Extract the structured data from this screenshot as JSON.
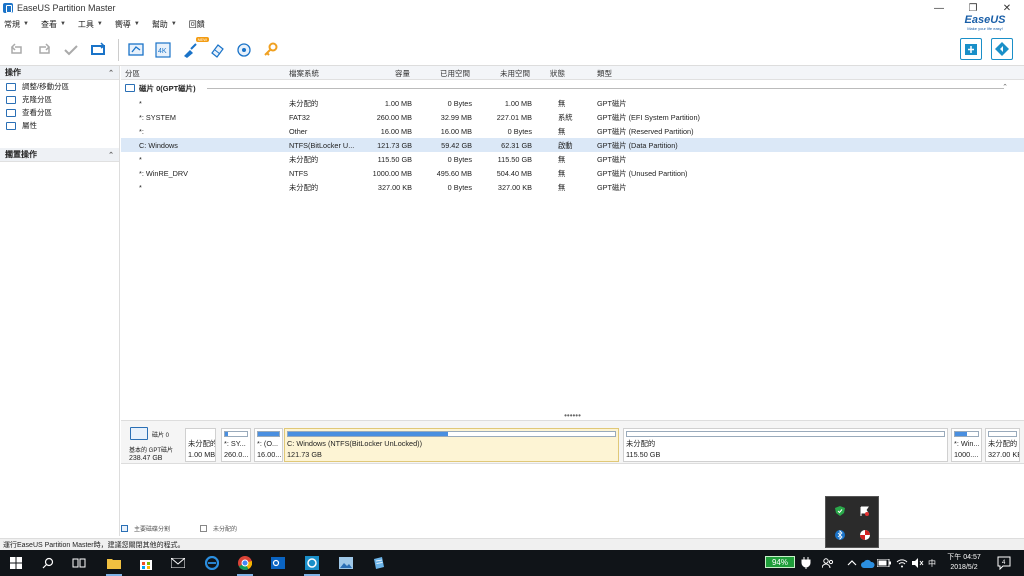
{
  "window": {
    "title": "EaseUS Partition Master",
    "minimize": "—",
    "maximize": "❐",
    "close": "✕"
  },
  "brand": {
    "name": "EaseUS",
    "tagline": "Make your life easy!"
  },
  "menu": [
    {
      "label": "常規"
    },
    {
      "label": "查看"
    },
    {
      "label": "工具"
    },
    {
      "label": "嚮導"
    },
    {
      "label": "幫助"
    },
    {
      "label": "回饋"
    }
  ],
  "toolbar": {
    "new_badge": "NEW",
    "icons": [
      "undo-icon",
      "redo-icon",
      "apply-icon",
      "refresh-icon",
      "migrate-os-icon",
      "4k-align-icon",
      "cleanup-icon",
      "wipe-icon",
      "disk-check-icon",
      "key-icon"
    ],
    "right_icons": [
      "winpe-icon",
      "layout-icon"
    ]
  },
  "left_panel": {
    "operations_header": "操作",
    "operations": [
      {
        "label": "調整/移動分區",
        "icon": "resize-icon"
      },
      {
        "label": "克隆分區",
        "icon": "clone-icon"
      },
      {
        "label": "查看分區",
        "icon": "explore-icon"
      },
      {
        "label": "屬性",
        "icon": "properties-icon"
      }
    ],
    "pending_header": "擱置操作"
  },
  "table": {
    "headers": [
      "分區",
      "檔案系統",
      "容量",
      "已用空間",
      "未用空間",
      "狀態",
      "類型"
    ],
    "disk_label": "磁片 0(GPT磁片)",
    "rows": [
      {
        "partition": "*",
        "fs": "未分配的",
        "capacity": "1.00 MB",
        "used": "0 Bytes",
        "unused": "1.00 MB",
        "status": "無",
        "type": "GPT磁片"
      },
      {
        "partition": "*: SYSTEM",
        "fs": "FAT32",
        "capacity": "260.00 MB",
        "used": "32.99 MB",
        "unused": "227.01 MB",
        "status": "系統",
        "type": "GPT磁片 (EFI System Partition)"
      },
      {
        "partition": "*:",
        "fs": "Other",
        "capacity": "16.00 MB",
        "used": "16.00 MB",
        "unused": "0 Bytes",
        "status": "無",
        "type": "GPT磁片 (Reserved Partition)"
      },
      {
        "partition": "C: Windows",
        "fs": "NTFS(BitLocker U...",
        "capacity": "121.73 GB",
        "used": "59.42 GB",
        "unused": "62.31 GB",
        "status": "啟動",
        "type": "GPT磁片 (Data Partition)",
        "selected": true
      },
      {
        "partition": "*",
        "fs": "未分配的",
        "capacity": "115.50 GB",
        "used": "0 Bytes",
        "unused": "115.50 GB",
        "status": "無",
        "type": "GPT磁片"
      },
      {
        "partition": "*: WinRE_DRV",
        "fs": "NTFS",
        "capacity": "1000.00 MB",
        "used": "495.60 MB",
        "unused": "504.40 MB",
        "status": "無",
        "type": "GPT磁片 (Unused Partition)"
      },
      {
        "partition": "*",
        "fs": "未分配的",
        "capacity": "327.00 KB",
        "used": "0 Bytes",
        "unused": "327.00 KB",
        "status": "無",
        "type": "GPT磁片"
      }
    ]
  },
  "splitter": "••••••",
  "disk_map": {
    "name": "磁片 0",
    "type": "基本的 GPT磁片",
    "size": "238.47 GB",
    "parts": [
      {
        "l1": "未分配的",
        "l2": "1.00 MB",
        "fill": 0,
        "bar": false
      },
      {
        "l1": "*: SY...",
        "l2": "260.0...",
        "fill": 0.13,
        "bar": true
      },
      {
        "l1": "*: (O...",
        "l2": "16.00...",
        "fill": 1.0,
        "bar": true
      },
      {
        "l1": "C: Windows (NTFS(BitLocker UnLocked))",
        "l2": "121.73 GB",
        "fill": 0.49,
        "bar": true,
        "selected": true
      },
      {
        "l1": "未分配的",
        "l2": "115.50 GB",
        "fill": 0,
        "bar": true
      },
      {
        "l1": "*: Win...",
        "l2": "1000....",
        "fill": 0.5,
        "bar": true
      },
      {
        "l1": "未分配的",
        "l2": "327.00 KB",
        "fill": 0,
        "bar": true
      }
    ]
  },
  "legend": {
    "primary": "主要磁碟分割",
    "unallocated": "未分配的"
  },
  "status_bar": "運行EaseUS Partition Master時，建議您關閉其他的程式。",
  "taskbar": {
    "battery": "94%",
    "ime": "中",
    "time": "下午 04:57",
    "date": "2018/5/2",
    "notifications": "4"
  }
}
